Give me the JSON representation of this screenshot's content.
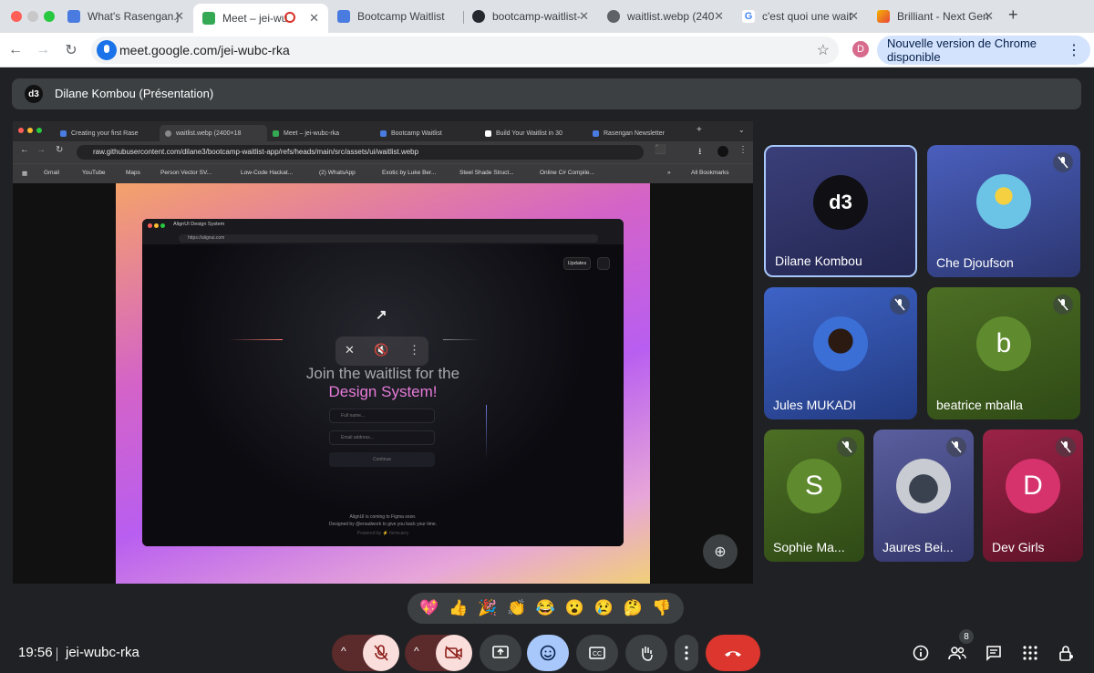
{
  "browser": {
    "tabs": [
      {
        "label": "What's Rasengan.j"
      },
      {
        "label": "Meet – jei-wub"
      },
      {
        "label": "Bootcamp Waitlist"
      },
      {
        "label": "bootcamp-waitlist-"
      },
      {
        "label": "waitlist.webp (240"
      },
      {
        "label": "c'est quoi une wait"
      },
      {
        "label": "Brilliant - Next Gen"
      }
    ],
    "new_tab": "+",
    "url": "meet.google.com/jei-wubc-rka",
    "profile_initial": "D",
    "update_label": "Nouvelle version de Chrome disponible"
  },
  "meet": {
    "presenter_logo": "d3",
    "presentation_title": "Dilane Kombou (Présentation)",
    "shared": {
      "tabs": [
        "Creating your first Rase",
        "waitlist.webp (2400×18",
        "Meet – jei-wubc-rka",
        "Bootcamp Waitlist",
        "Build Your Waitlist in 30",
        "Rasengan Newsletter"
      ],
      "url": "raw.githubusercontent.com/dilane3/bootcamp-waitlist-app/refs/heads/main/src/assets/ui/waitlist.webp",
      "bookmarks": [
        "Gmail",
        "YouTube",
        "Maps",
        "Person Vector SV...",
        "Low-Code Hackat...",
        "(2) WhatsApp",
        "Exotic by Luke Ber...",
        "Steel Shade Struct...",
        "Online C# Compile...",
        "»",
        "All Bookmarks"
      ],
      "app": {
        "tab_name": "AlignUI Design System",
        "url": "https://alignui.com",
        "updates": "Updates",
        "headline_1": "Join the waitlist for the",
        "headline_2": "Design System!",
        "name_placeholder": "Full name...",
        "email_placeholder": "Email address...",
        "continue": "Continue",
        "footer_1": "AlignUI is coming to Figma soon.",
        "footer_2": "Designed by @ersadwork to give you back your time.",
        "footer_3": "Powered by ⚡ formcarry"
      }
    },
    "participants": [
      {
        "name": "Dilane Kombou",
        "initial": "d3",
        "color": "#0f0f14"
      },
      {
        "name": "Che Djoufson",
        "initial": "",
        "color": "#6bc3e6"
      },
      {
        "name": "Jules MUKADI",
        "initial": "",
        "color": "#3b6fd6"
      },
      {
        "name": "beatrice mballa",
        "initial": "b",
        "color": "#5f8b2e"
      },
      {
        "name": "Sophie Ma...",
        "initial": "S",
        "color": "#5f8b2e"
      },
      {
        "name": "Jaures Bei...",
        "initial": "",
        "color": "#9aa0a6"
      },
      {
        "name": "Dev Girls",
        "initial": "D",
        "color": "#d6336c"
      }
    ],
    "reactions": [
      "💖",
      "👍",
      "🎉",
      "👏",
      "😂",
      "😮",
      "😢",
      "🤔",
      "👎"
    ],
    "time": "19:56",
    "meeting_code": "jei-wubc-rka",
    "participant_count": "8"
  }
}
